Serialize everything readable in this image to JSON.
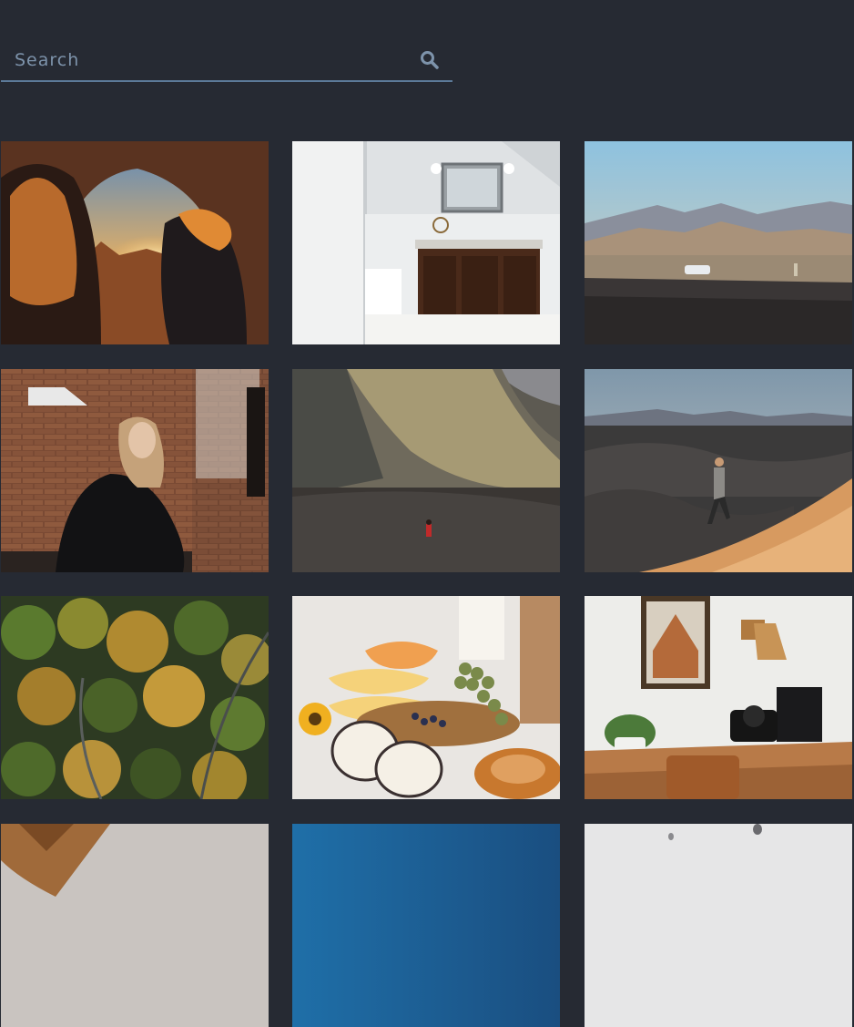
{
  "search": {
    "placeholder": "Search",
    "value": ""
  },
  "icons": {
    "search": "search-icon"
  },
  "colors": {
    "background": "#262a33",
    "search_underline": "#5c7a99",
    "search_text": "#7d93ab"
  },
  "gallery": {
    "photos": [
      {
        "subject": "two-women-desert-arch-sunset"
      },
      {
        "subject": "white-bathroom-wooden-vanity"
      },
      {
        "subject": "mountain-valley-car-traveler"
      },
      {
        "subject": "woman-crouching-brick-wall"
      },
      {
        "subject": "hiker-red-jacket-volcanic-hill"
      },
      {
        "subject": "hiker-sand-dunes"
      },
      {
        "subject": "aerial-autumn-forest"
      },
      {
        "subject": "breakfast-melon-grapes-pastry"
      },
      {
        "subject": "desk-rotary-phone-lamp"
      },
      {
        "subject": "partial-photo-foliage"
      },
      {
        "subject": "partial-photo-blue-sky"
      },
      {
        "subject": "partial-photo-hot-air-balloons"
      }
    ]
  }
}
